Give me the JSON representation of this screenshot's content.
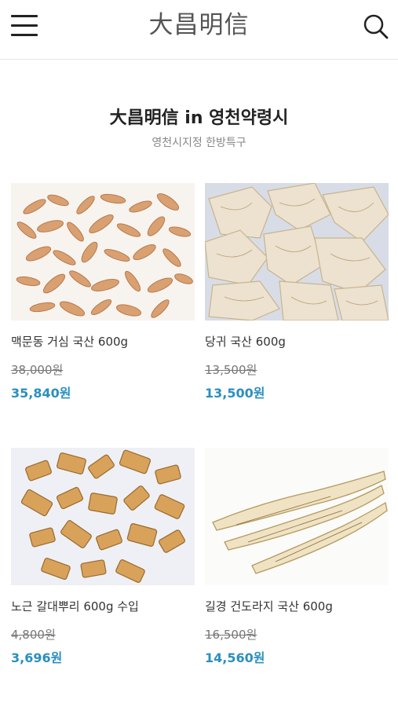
{
  "header": {
    "logo": "大昌明信",
    "menu_icon": "hamburger-menu-icon",
    "search_icon": "search-icon"
  },
  "shop": {
    "title": "大昌明信 in 영천약령시",
    "subtitle": "영천시지정 한방특구"
  },
  "colors": {
    "sale_price": "#2a8fbd",
    "original_price": "#777777",
    "divider": "#e6e6e6"
  },
  "products": [
    {
      "name": "맥문동 거심 국산 600g",
      "original_price": "38,000원",
      "sale_price": "35,840원",
      "image": "maekmundong-roots-photo"
    },
    {
      "name": "당귀 국산 600g",
      "original_price": "13,500원",
      "sale_price": "13,500원",
      "image": "danggwi-slices-photo"
    },
    {
      "name": "노근 갈대뿌리 600g 수입",
      "original_price": "4,800원",
      "sale_price": "3,696원",
      "image": "reed-root-pieces-photo"
    },
    {
      "name": "길경 건도라지 국산 600g",
      "original_price": "16,500원",
      "sale_price": "14,560원",
      "image": "dried-bellflower-root-photo"
    }
  ]
}
